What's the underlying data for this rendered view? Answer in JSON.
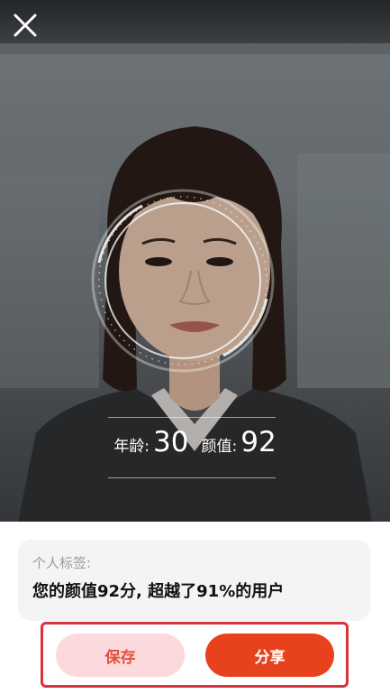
{
  "header": {
    "close_icon": "close-icon"
  },
  "result": {
    "age_label": "年龄:",
    "age_value": "30",
    "score_label": "颜值:",
    "score_value": "92"
  },
  "tag_card": {
    "label": "个人标签:",
    "text": "您的颜值92分, 超越了91%的用户"
  },
  "actions": {
    "save_label": "保存",
    "share_label": "分享"
  },
  "colors": {
    "share_bg": "#e8411d",
    "save_bg": "#fbd9dd",
    "save_text": "#e3503a",
    "highlight_border": "#d6333b"
  }
}
